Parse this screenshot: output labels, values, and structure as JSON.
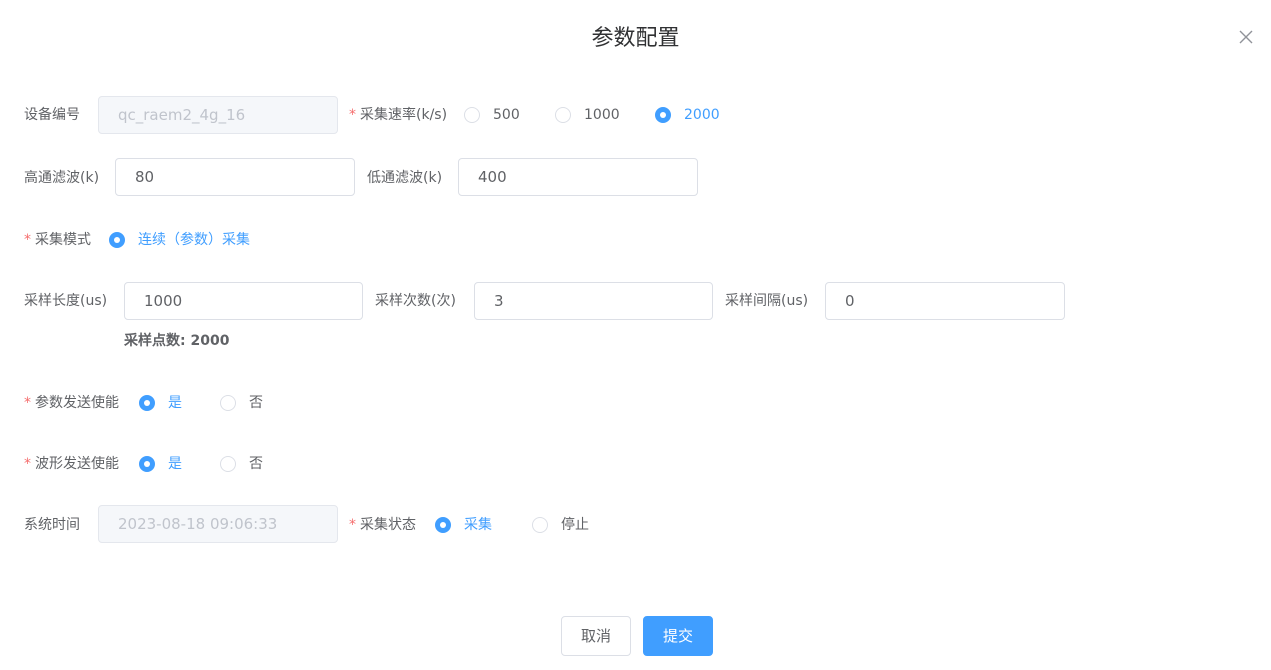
{
  "dialog": {
    "title": "参数配置"
  },
  "device": {
    "label": "设备编号",
    "value": "qc_raem2_4g_16"
  },
  "sample_rate": {
    "label": "采集速率(k/s)",
    "options": [
      "500",
      "1000",
      "2000"
    ],
    "selected": "2000"
  },
  "filters": {
    "high_pass": {
      "label": "高通滤波(k)",
      "value": "80"
    },
    "low_pass": {
      "label": "低通滤波(k)",
      "value": "400"
    }
  },
  "acq_mode": {
    "label": "采集模式",
    "options": [
      "连续（参数）采集"
    ],
    "selected": "连续（参数）采集"
  },
  "sampling": {
    "length": {
      "label": "采样长度(us)",
      "value": "1000"
    },
    "count": {
      "label": "采样次数(次)",
      "value": "3"
    },
    "interval": {
      "label": "采样间隔(us)",
      "value": "0"
    },
    "points_text": "采样点数: 2000"
  },
  "param_send": {
    "label": "参数发送使能",
    "options": [
      "是",
      "否"
    ],
    "selected": "是"
  },
  "wave_send": {
    "label": "波形发送使能",
    "options": [
      "是",
      "否"
    ],
    "selected": "是"
  },
  "system_time": {
    "label": "系统时间",
    "value": "2023-08-18 09:06:33"
  },
  "acq_status": {
    "label": "采集状态",
    "options": [
      "采集",
      "停止"
    ],
    "selected": "采集"
  },
  "footer": {
    "cancel_label": "取消",
    "submit_label": "提交"
  },
  "colors": {
    "primary": "#409eff",
    "required": "#f56c6c",
    "text": "#606266",
    "border": "#dcdfe6"
  },
  "icons": {
    "close": "close-icon"
  }
}
